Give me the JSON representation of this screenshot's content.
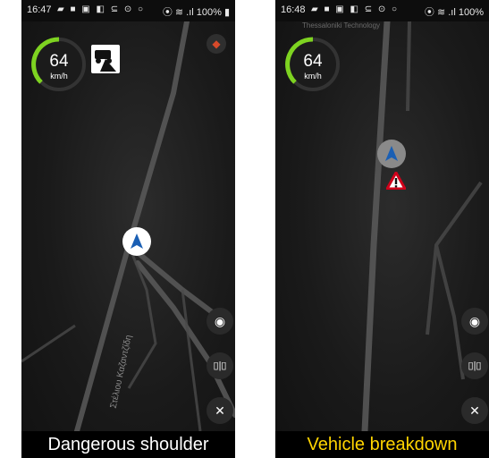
{
  "panels": [
    {
      "time": "16:47",
      "notif_icons": "▰ ■ ▣ ◧ ⊆ ⊙ ○",
      "system": "⦿ ≋ .ıl 100% ▮",
      "speed": "64",
      "unit": "km/h",
      "street_label": "Στέλιου Καζαντζίδη",
      "warning_sign": "dangerous-shoulder-sign",
      "caption": "Dangerous shoulder",
      "caption_color": "#ffffff"
    },
    {
      "time": "16:48",
      "notif_icons": "▰ ■ ▣ ◧ ⊆ ⊙ ○",
      "system": "⦿ ≋ .ıl 100%",
      "speed": "64",
      "unit": "km/h",
      "map_label": "Thessaloniki Technology",
      "warning_sign": "warning-triangle",
      "caption": "Vehicle breakdown",
      "caption_color": "#ffd400"
    }
  ],
  "buttons": {
    "locate_icon": "◉",
    "split_icon": "▯|▯",
    "tools_icon": "✕"
  },
  "colors": {
    "speed_arc": "#7ed321",
    "nav_arrow": "#1a5fb4",
    "road": "#6a6a6a"
  }
}
